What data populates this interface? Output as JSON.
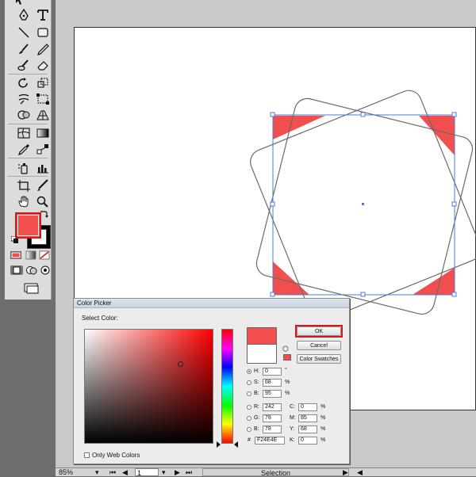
{
  "colors": {
    "accent_fill": "#f24e4e",
    "highlight": "#d11a1a",
    "selection": "#4a7bd8"
  },
  "tools": {
    "items": [
      "selection-tool",
      "type-tool",
      "pen-tool",
      "line-tool",
      "rectangle-tool",
      "paintbrush-tool",
      "pencil-tool",
      "blob-brush-tool",
      "eraser-tool",
      "rotate-tool",
      "scale-tool",
      "warp-tool",
      "free-transform-tool",
      "shape-builder-tool",
      "perspective-grid-tool",
      "mesh-tool",
      "gradient-tool",
      "eyedropper-tool",
      "blend-tool",
      "symbol-sprayer-tool",
      "column-graph-tool",
      "artboard-tool",
      "slice-tool",
      "hand-tool",
      "zoom-tool"
    ]
  },
  "dialog": {
    "title": "Color Picker",
    "select_label": "Select Color:",
    "ok_label": "OK",
    "cancel_label": "Cancel",
    "swatches_label": "Color Swatches",
    "only_web_label": "Only Web Colors",
    "hsb": [
      {
        "label": "H:",
        "value": "0",
        "unit": "°"
      },
      {
        "label": "S:",
        "value": "68",
        "unit": "%"
      },
      {
        "label": "B:",
        "value": "95",
        "unit": "%"
      }
    ],
    "rgb": [
      {
        "label": "R:",
        "value": "242"
      },
      {
        "label": "G:",
        "value": "78"
      },
      {
        "label": "B:",
        "value": "78"
      }
    ],
    "cmyk": [
      {
        "label": "C:",
        "value": "0",
        "unit": "%"
      },
      {
        "label": "M:",
        "value": "85",
        "unit": "%"
      },
      {
        "label": "Y:",
        "value": "68",
        "unit": "%"
      },
      {
        "label": "K:",
        "value": "0",
        "unit": "%"
      }
    ],
    "hex_label": "#",
    "hex_value": "F24E4E"
  },
  "statusbar": {
    "zoom": "85%",
    "artboard_number": "1",
    "mode": "Selection"
  }
}
